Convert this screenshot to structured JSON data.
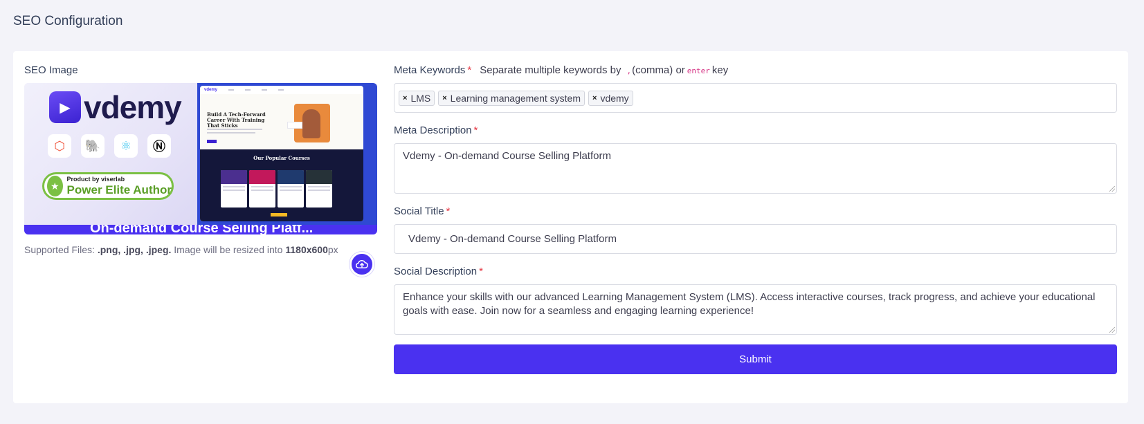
{
  "page_title": "SEO Configuration",
  "seo_image": {
    "label": "SEO Image",
    "preview": {
      "logo_text": "vdemy",
      "badge_small": "Product by viserlab",
      "badge_big": "Power Elite Author",
      "hero_title": "Build A Tech-Forward Career With Training That Sticks",
      "courses_title": "Our Popular Courses",
      "strip_text": "On-demand Course Selling Platf..."
    },
    "supported_prefix": "Supported Files:",
    "supported_types": ".png, .jpg, .jpeg.",
    "resize_text": "Image will be resized into",
    "resize_size": "1180x600",
    "resize_unit": "px"
  },
  "meta_keywords": {
    "label": "Meta Keywords",
    "required": "*",
    "hint_prefix": "Separate multiple keywords by",
    "hint_comma": ",",
    "hint_comma_text": "(comma) or",
    "hint_enter": "enter",
    "hint_key": "key",
    "chips": [
      "LMS",
      "Learning management system",
      "vdemy"
    ],
    "chip_remove": "×"
  },
  "meta_description": {
    "label": "Meta Description",
    "required": "*",
    "value": "Vdemy - On-demand Course Selling Platform"
  },
  "social_title": {
    "label": "Social Title",
    "required": "*",
    "value": "Vdemy - On-demand Course Selling Platform"
  },
  "social_description": {
    "label": "Social Description",
    "required": "*",
    "value": "Enhance your skills with our advanced Learning Management System (LMS). Access interactive courses, track progress, and achieve your educational goals with ease. Join now for a seamless and engaging learning experience!"
  },
  "submit_label": "Submit",
  "colors": {
    "accent": "#4a31f0",
    "required": "#e53945",
    "background": "#f3f3f9"
  },
  "icons": {
    "upload": "cloud-upload-icon",
    "chip_remove": "close-icon"
  }
}
